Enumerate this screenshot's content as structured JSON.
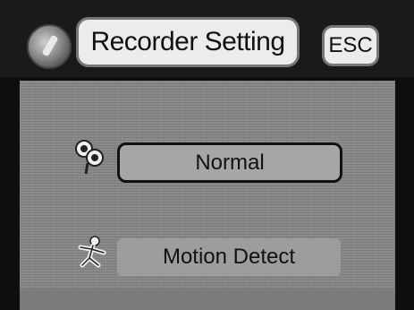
{
  "header": {
    "title": "Recorder Setting",
    "esc_label": "ESC"
  },
  "options": [
    {
      "label": "Normal",
      "icon": "camera-icon",
      "selected": true
    },
    {
      "label": "Motion Detect",
      "icon": "motion-figure-icon",
      "selected": false
    }
  ],
  "colors": {
    "background": "#0d0d0d",
    "panel": "#888888",
    "button_face": "#ececec",
    "selected_border": "#111111"
  }
}
